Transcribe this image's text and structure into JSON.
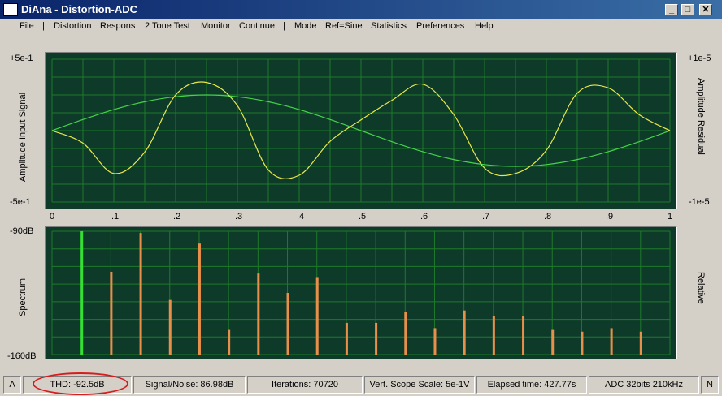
{
  "window": {
    "title": "DiAna - Distortion-ADC",
    "buttons": {
      "minimize": "_",
      "maximize": "□",
      "close": "✕"
    }
  },
  "menu": [
    "File",
    "|",
    "Distortion",
    "Respons",
    "2 Tone Test",
    "Monitor",
    "Continue",
    "|",
    "Mode",
    "Ref=Sine",
    "Statistics",
    "Preferences",
    "Help"
  ],
  "scope": {
    "left_top": "+5e-1",
    "left_bottom": "-5e-1",
    "right_top": "+1e-5",
    "right_bottom": "-1e-5",
    "left_label": "Amplitude Input Signal",
    "right_label": "Amplitude Residual",
    "x_ticks": [
      "0",
      ".1",
      ".2",
      ".3",
      ".4",
      ".5",
      ".6",
      ".7",
      ".8",
      ".9",
      "1"
    ],
    "colors": {
      "background": "#0e3a2a",
      "grid": "#1f7a2a",
      "signal": "#44d24a",
      "residual": "#e8e84a"
    }
  },
  "spectrum": {
    "top_label": "-90dB",
    "bottom_label": "-160dB",
    "left_label": "Spectrum",
    "right_label": "Relative",
    "colors": {
      "fundamental": "#33e033",
      "harmonics": "#e8904a"
    }
  },
  "chart_data": [
    {
      "type": "line",
      "x": [
        0,
        0.05,
        0.1,
        0.15,
        0.2,
        0.25,
        0.3,
        0.35,
        0.4,
        0.45,
        0.5,
        0.55,
        0.6,
        0.65,
        0.7,
        0.75,
        0.8,
        0.85,
        0.9,
        0.95,
        1
      ],
      "ylim": [
        -1,
        1
      ],
      "series": [
        {
          "values": [
            0,
            0.31,
            0.59,
            0.81,
            0.95,
            1,
            0.95,
            0.81,
            0.59,
            0.31,
            0,
            -0.31,
            -0.59,
            -0.81,
            -0.95,
            -1,
            -0.95,
            -0.81,
            -0.59,
            -0.31,
            0
          ]
        },
        {
          "values": [
            0,
            -0.35,
            -1.2,
            -0.6,
            1.0,
            1.35,
            0.7,
            -1.1,
            -1.25,
            -0.3,
            0.3,
            0.85,
            1.3,
            0.45,
            -1.05,
            -1.2,
            -0.55,
            1.05,
            1.2,
            0.45,
            0
          ]
        }
      ]
    },
    {
      "type": "bar",
      "ylim": [
        -160,
        -90
      ],
      "values": [
        -90,
        -113,
        -91,
        -129,
        -97,
        -146,
        -114,
        -125,
        -116,
        -142,
        -142,
        -136,
        -145,
        -135,
        -138,
        -138,
        -146,
        -147,
        -145,
        -147
      ]
    }
  ],
  "status": {
    "mode": "A",
    "thd": "THD:  -92.5dB",
    "snr": "Signal/Noise:  86.98dB",
    "iterations": "Iterations: 70720",
    "vscale": "Vert. Scope Scale: 5e-1V",
    "elapsed": "Elapsed time: 427.77s",
    "adc": "ADC 32bits 210kHz",
    "flag": "N"
  }
}
